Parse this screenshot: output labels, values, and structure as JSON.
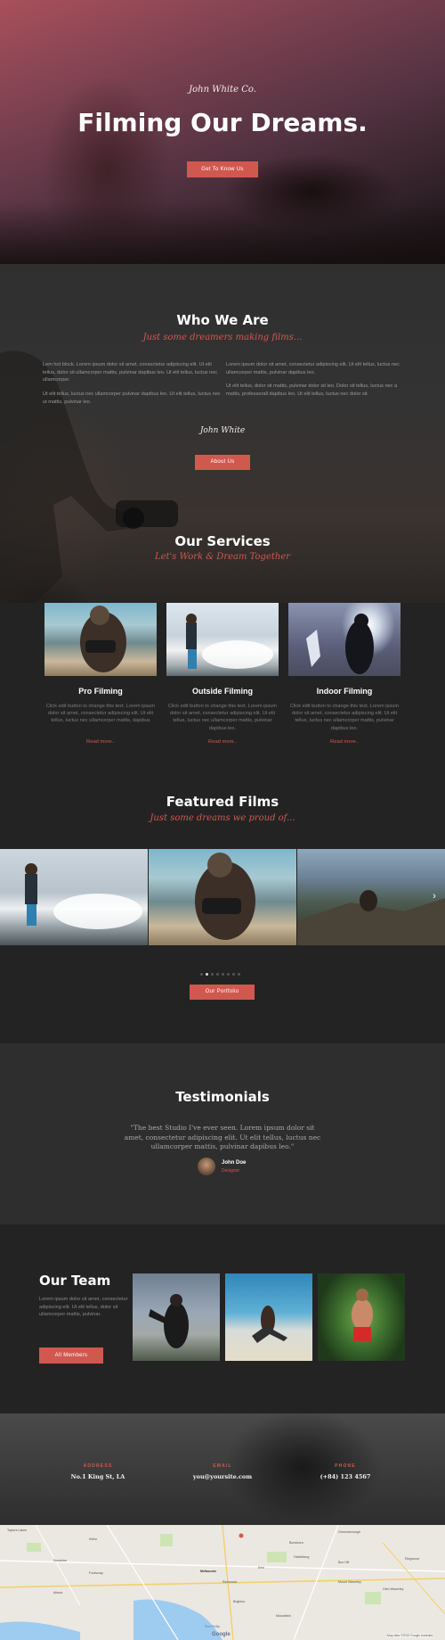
{
  "hero": {
    "signature": "John White Co.",
    "title": "Filming Our Dreams.",
    "cta": "Get To Know Us"
  },
  "who": {
    "title": "Who We Are",
    "subtitle": "Just some dreamers making films...",
    "col1_p1": "Lem hot block. Lorem ipsum dolor sit amet, consectetur adipiscing elit. Ut elit tellus, dolor sit ullamcorper mattis, pulvinar dapibus leo. Ut elit tellus, luctus nec ullamcorper.",
    "col1_p2": "Ut elit tellus, luctus nec ullamcorper pulvinar dapibus leo. Ut elit tellus, luctus nec ut mattis, pulvinar leo.",
    "col2_p1": "Lorem ipsum dolor sit amet, consectetur adipiscing elit. Ut elit tellus, luctus nec ullamcorper mattis, pulvinar dapibus leo.",
    "col2_p2": "Ut elit tellus, dolor sit mattis, pulvinar dolor sit leo. Dolor sit tellus, luctus nec a mattis, professorall dapibus leo. Ut elit tellus, luctus nec dolor sit.",
    "signature": "John White",
    "button": "About Us"
  },
  "services": {
    "title": "Our Services",
    "subtitle": "Let's Work & Dream Together",
    "items": [
      {
        "title": "Pro Filming",
        "desc": "Click edit button to change this text. Lorem ipsum dolor sit amet, consectetur adipiscing elit. Ut elit tellus, luctus nec ullamcorper mattis, dapibus",
        "more": "Read more.."
      },
      {
        "title": "Outside Filming",
        "desc": "Click edit button to change this text. Lorem ipsum dolor sit amet, consectetur adipiscing elit. Ut elit tellus, luctus nec ullamcorper mattis, pulvinar dapibus leo.",
        "more": "Read more.."
      },
      {
        "title": "Indoor Filming",
        "desc": "Click edit button to change this text. Lorem ipsum dolor sit amet, consectetur adipiscing elit. Ut elit tellus, luctus nec ullamcorper mattis, pulvinar dapibus leo.",
        "more": "Read more.."
      }
    ]
  },
  "films": {
    "title": "Featured Films",
    "subtitle": "Just some dreams we proud of...",
    "next_icon": "chevron-right-icon",
    "button": "Our Portfolio"
  },
  "testimonials": {
    "title": "Testimonials",
    "quote": "\"The best Studio I've ever seen. Lorem ipsum dolor sit amet, consectetur adipiscing elit. Ut elit tellus, luctus nec ullamcorper mattis, pulvinar dapibus leo.\"",
    "name": "John Doe",
    "role": "Designer"
  },
  "team": {
    "title": "Our Team",
    "desc": "Lorem ipsum dolor sit amet, consectetur adipiscing elit. Ut elit tellus, dolor sit ullamcorper mattis, pulvinar.",
    "button": "All Members"
  },
  "contact": {
    "address_label": "ADDRESS",
    "address_value": "No.1 King St, LA",
    "email_label": "EMAIL",
    "email_value": "you@yoursite.com",
    "phone_label": "PHONE",
    "phone_value": "(+84) 123 4567"
  },
  "map": {
    "brand": "Google",
    "labels": [
      "Taylors Lakes",
      "Greensborough",
      "Keilor",
      "Bundoora",
      "Sunshine",
      "Heidelberg",
      "Footscray",
      "Kew",
      "Altona",
      "Melbourne",
      "Richmond",
      "Box Hill",
      "Ringwood",
      "Glen Waverley",
      "Brighton",
      "Mount Waverley",
      "Moorabbin",
      "Port Phillip"
    ],
    "footer": "Map data ©2019 Google   Australia"
  },
  "colors": {
    "accent": "#d1584f",
    "bg_dark": "#232323",
    "bg_mid": "#2e2e2e"
  }
}
